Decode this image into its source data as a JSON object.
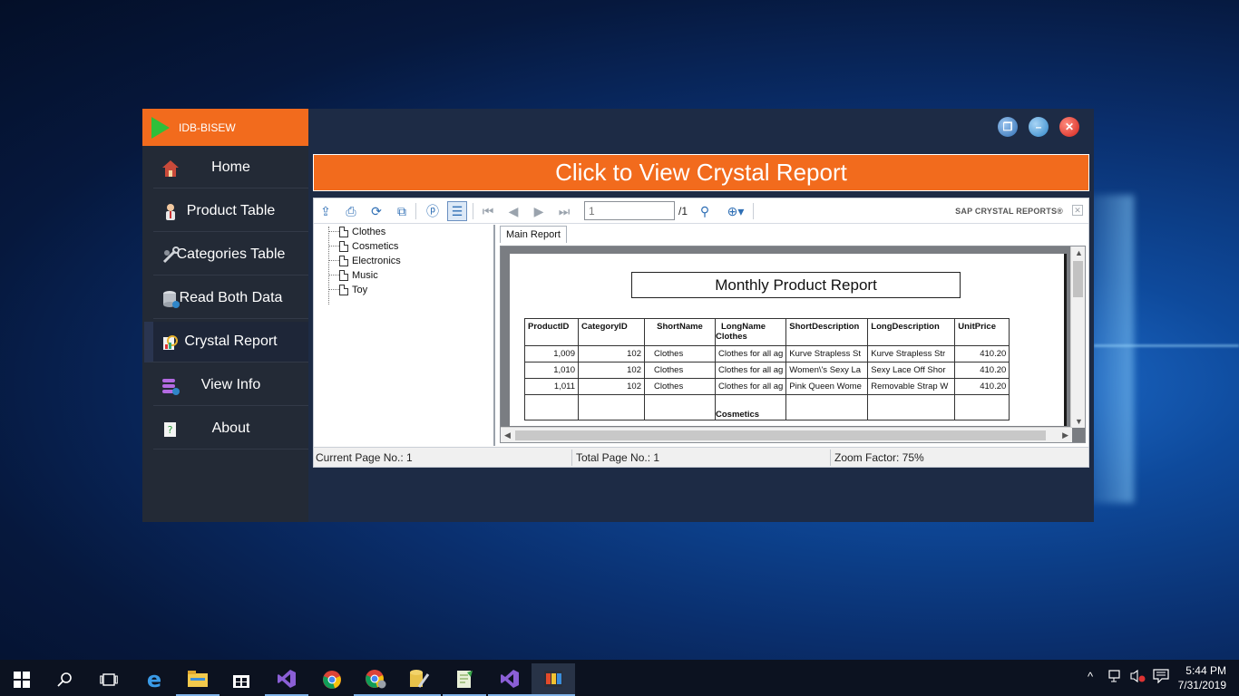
{
  "app": {
    "brand_label": "IDB-BISEW",
    "banner_text": "Click to View Crystal Report"
  },
  "sidebar": {
    "items": [
      {
        "label": "Home",
        "icon": "house-icon"
      },
      {
        "label": "Product Table",
        "icon": "person-icon"
      },
      {
        "label": "Categories Table",
        "icon": "tools-icon"
      },
      {
        "label": "Read Both Data",
        "icon": "database-icon"
      },
      {
        "label": "Crystal Report",
        "icon": "report-icon",
        "active": true
      },
      {
        "label": "View Info",
        "icon": "info-stack-icon"
      },
      {
        "label": "About",
        "icon": "help-icon"
      }
    ]
  },
  "viewer": {
    "page_input": "1",
    "page_total": "/1",
    "brand": "SAP CRYSTAL REPORTS®",
    "tab_label": "Main Report",
    "group_tree": [
      "Clothes",
      "Cosmetics",
      "Electronics",
      "Music",
      "Toy"
    ],
    "report": {
      "title": "Monthly Product Report",
      "headers": [
        "ProductID",
        "CategoryID",
        "ShortName",
        "LongName",
        "ShortDescription",
        "LongDescription",
        "UnitPrice"
      ],
      "longname_header_sub": "Clothes",
      "rows": [
        [
          "1,009",
          "102",
          "Clothes",
          "Clothes for all ag",
          "Kurve Strapless St",
          "Kurve Strapless Str",
          "410.20"
        ],
        [
          "1,010",
          "102",
          "Clothes",
          "Clothes for all ag",
          "Women\\'s Sexy La",
          "Sexy Lace Off Shor",
          "410.20"
        ],
        [
          "1,011",
          "102",
          "Clothes",
          "Clothes for all ag",
          "Pink Queen Wome",
          "Removable Strap W",
          "410.20"
        ]
      ],
      "group_label": "Cosmetics"
    },
    "status": {
      "current_page": "Current Page No.: 1",
      "total_page": "Total Page No.: 1",
      "zoom": "Zoom Factor: 75%"
    }
  },
  "taskbar": {
    "time": "5:44 PM",
    "date": "7/31/2019"
  }
}
